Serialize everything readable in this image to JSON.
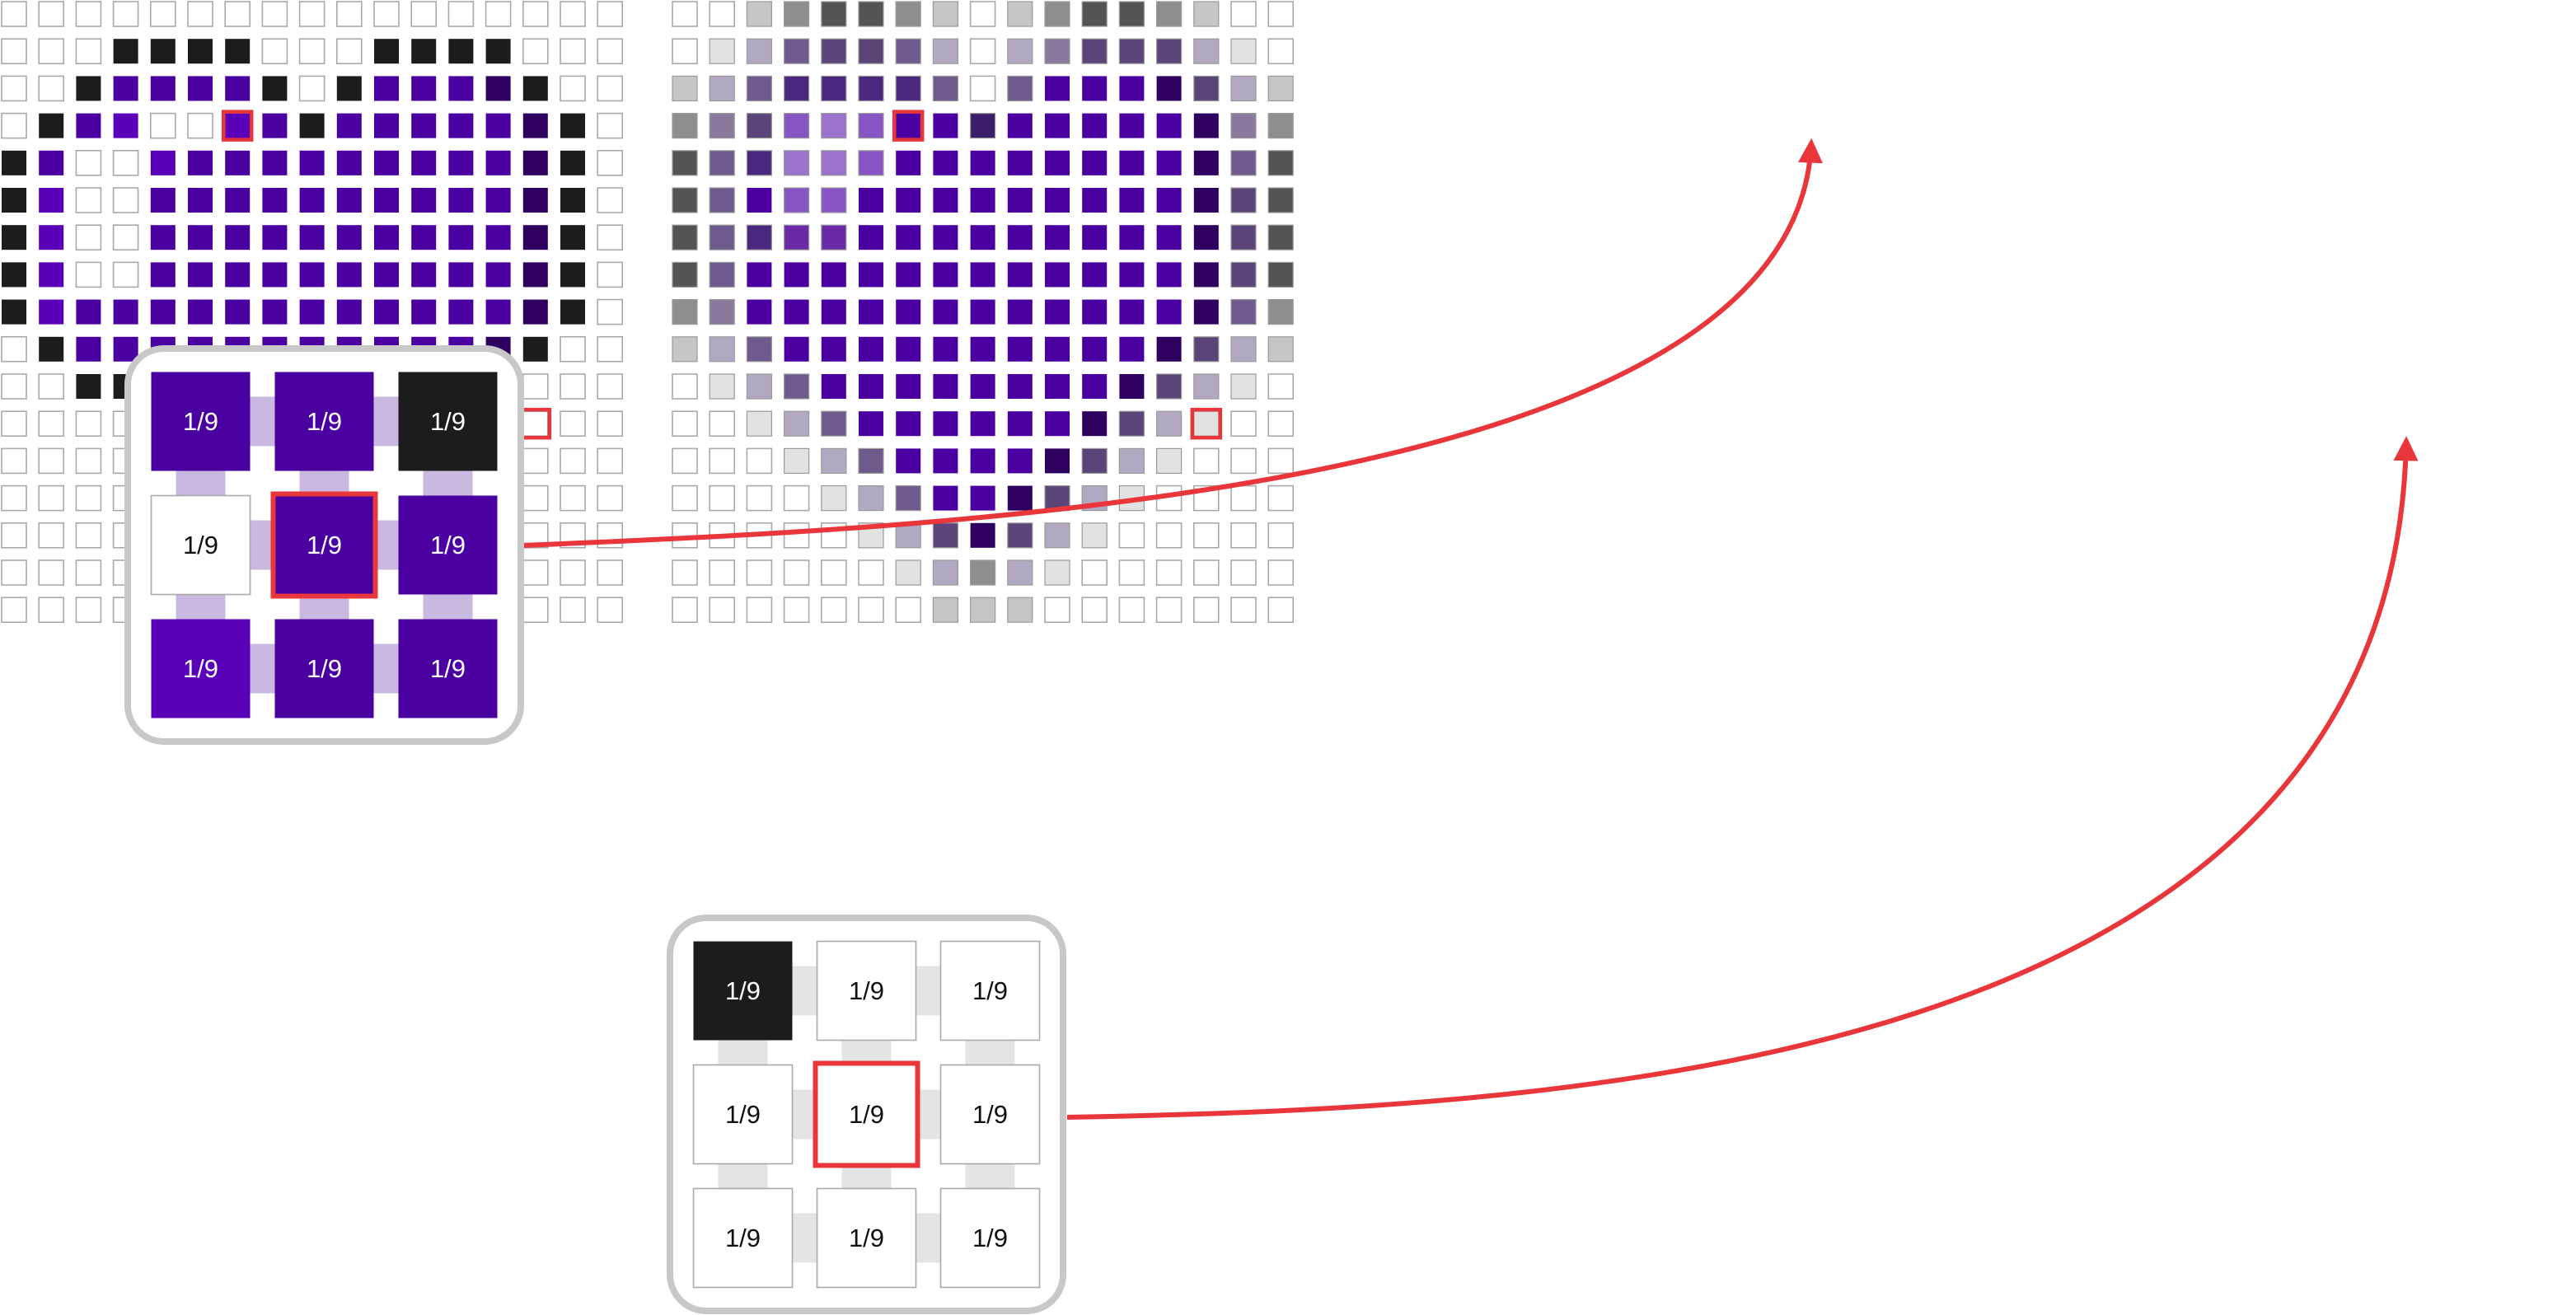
{
  "palette": {
    "W": "#ffffff",
    "K": "#1c1c1c",
    "P": "#4a00a0",
    "Q": "#5a00b8",
    "D": "#2e005f",
    "H": "#7a35c5",
    "L": "#c9b8e0",
    "l1": "#e2e2e2",
    "l2": "#c6c6c6",
    "m1": "#b2a8c2",
    "m2": "#a8a8a8",
    "g1": "#8e8e8e",
    "g2": "#8a7a9e",
    "g3": "#6e5a8c",
    "g4": "#5a4478",
    "g5": "#545454",
    "g6": "#9b72cc",
    "g7": "#8855c4",
    "g8": "#6a2aa8",
    "g9": "#4a2880",
    "g10": "#3a1e6a",
    "highlight": "#e8363a",
    "inset_border": "#c8c8c8",
    "cell_border": "#a9a9a9"
  },
  "left_grid": [
    "W W W W W W W W W W W W W W W W W",
    "W W W K K K K W W W K K K K W W W",
    "W W K P P P P K W K P P P D K W W",
    "W K P Q W W Q P K P P P P P D K W",
    "K P W W Q P P P P P P P P P D K W",
    "K Q W W P P P P P P P P P P D K W",
    "K Q W W P P P P P P P P P P D K W",
    "K Q W W P P P P P P P P P P D K W",
    "K Q P P P P P P P P P P P P D K W",
    "W K P P P P P P P P P P P D K W W",
    "W W K K P P P P P P P P D K W W W",
    "W W W W K P P P P P P D K W W W W",
    "W W W W W K P P P P P K W W W W W",
    "W W W W W W K P P P D W W W W W W",
    "W W W W W W W K D W W W W W W W W",
    "W W W W W W W W K W W W W W W W W",
    "W W W W W W W W W W W W W W W W W"
  ],
  "right_grid": [
    "W W l2 g1 g5 g5 g1 l2 W l2 g1 g5 g5 g1 l2 W W",
    "W l1 m1 g3 g4 g4 g3 m1 W m1 g2 g4 g4 g4 m1 l1 W",
    "l2 m1 g3 g9 g9 g9 g9 g3 W g3 P P P D g4 m1 l2",
    "g1 g2 g4 g7 g6 g7 P P g10 P P P P P D g2 g1",
    "g5 g3 g9 g6 g6 g7 P P P P P P P P D g3 g5",
    "g5 g3 P g7 g7 P P P P P P P P P D g4 g5",
    "g5 g3 g9 g8 g8 P P P P P P P P P D g4 g5",
    "g5 g3 P P P P P P P P P P P P D g4 g5",
    "g1 g2 P P P P P P P P P P P P D g3 g1",
    "l2 m1 g3 P P P P P P P P P P D g4 m1 l2",
    "W l1 m1 g3 P P P P P P P P D g4 m1 l1 W",
    "W W l1 m1 g3 P P P P P P D g4 m1 l1 W W",
    "W W W l1 m1 g3 P P P P D g4 m1 l1 W W W",
    "W W W W l1 m1 g3 P P D g4 m1 l1 W W W W",
    "W W W W W l1 m1 g4 D g4 m1 l1 W W W W W",
    "W W W W W W l1 m1 g1 m1 l1 W W W W W W",
    "W W W W W W W l2 l2 l2 W W W W W W W"
  ],
  "kernel_a": {
    "cells": [
      "P",
      "P",
      "K",
      "W",
      "P",
      "P",
      "Q",
      "P",
      "P"
    ],
    "labels": [
      "1/9",
      "1/9",
      "1/9",
      "1/9",
      "1/9",
      "1/9",
      "1/9",
      "1/9",
      "1/9"
    ]
  },
  "kernel_b": {
    "cells": [
      "K",
      "W",
      "W",
      "W",
      "W",
      "W",
      "W",
      "W",
      "W"
    ],
    "labels": [
      "1/9",
      "1/9",
      "1/9",
      "1/9",
      "1/9",
      "1/9",
      "1/9",
      "1/9",
      "1/9"
    ]
  },
  "highlights": {
    "left": [
      [
        3,
        6
      ],
      [
        11,
        14
      ]
    ],
    "right": [
      [
        3,
        6
      ],
      [
        11,
        14
      ]
    ]
  }
}
